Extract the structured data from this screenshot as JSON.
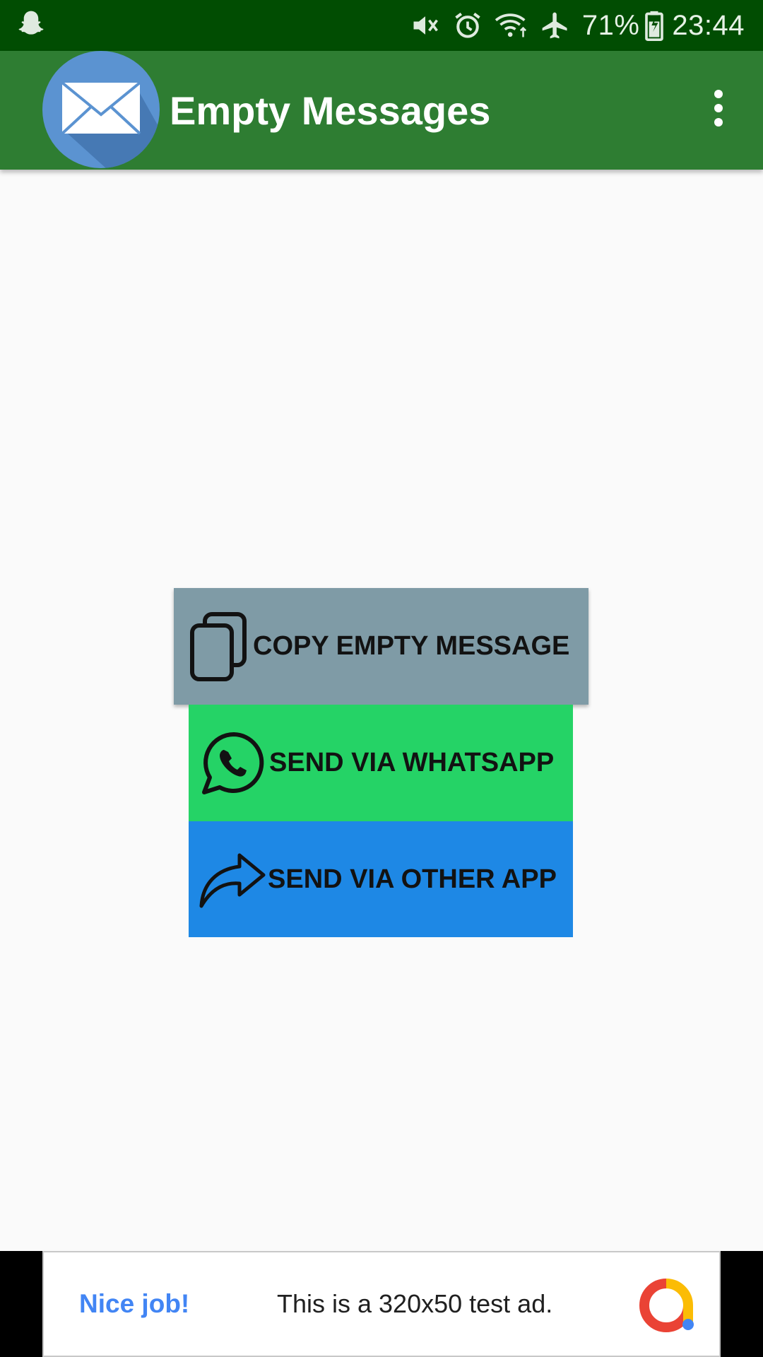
{
  "status_bar": {
    "battery_percent": "71%",
    "time": "23:44",
    "icons": [
      "snapchat-ghost-icon",
      "mute-icon",
      "alarm-icon",
      "wifi-icon",
      "airplane-icon",
      "battery-icon"
    ]
  },
  "app_bar": {
    "title": "Empty Messages",
    "logo_icon": "envelope-icon",
    "overflow_icon": "more-vert-icon"
  },
  "actions": {
    "copy_label": "COPY EMPTY MESSAGE",
    "whatsapp_label": "SEND VIA WHATSAPP",
    "other_label": "SEND VIA OTHER APP"
  },
  "ad": {
    "headline": "Nice job!",
    "body": "This is a 320x50 test ad."
  },
  "colors": {
    "status_bar": "#014d02",
    "app_bar": "#2e7d32",
    "copy_button": "#7f9ba6",
    "whatsapp_button": "#25d366",
    "other_button": "#1e88e5",
    "background": "#fafafa"
  }
}
